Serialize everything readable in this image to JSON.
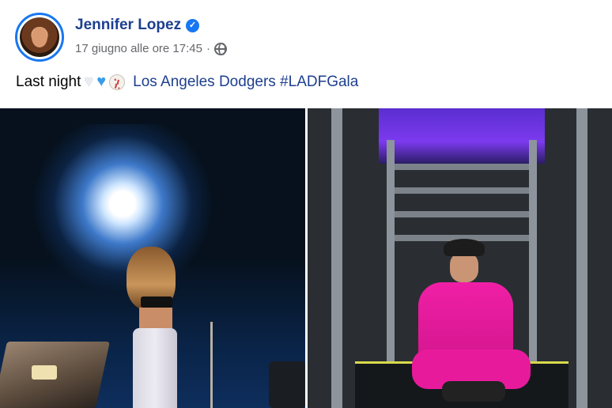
{
  "post": {
    "author": "Jennifer Lopez",
    "verified_icon": "verified-badge-icon",
    "timestamp": "17 giugno alle ore 17:45",
    "separator": "·",
    "audience_icon": "globe-icon",
    "text_prefix": "Last night",
    "emojis": [
      "white-heart",
      "blue-heart",
      "baseball"
    ],
    "text_suffix": "Los Angeles Dodgers #LADFGala"
  },
  "photos": {
    "left": "stage-performance-photo",
    "right": "backstage-corridor-photo"
  },
  "colors": {
    "link": "#1d3f8f",
    "verified": "#1877f2",
    "meta": "#65676b"
  }
}
